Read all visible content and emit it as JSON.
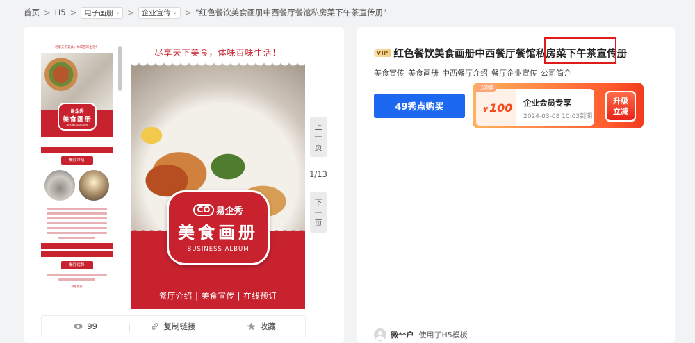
{
  "breadcrumb": {
    "home": "首页",
    "sep": ">",
    "h5": "H5",
    "cat1": "电子画册",
    "cat2": "企业宣传",
    "current": "\"红色餐饮美食画册中西餐厅餐馆私房菜下午茶宣传册\""
  },
  "preview": {
    "thumb_top_text": "尽享天下美食，体味百味生活！",
    "thumb_logo": "易企秀",
    "thumb_title": "美食画册",
    "thumb_sub": "BUSINESS ALBUM",
    "thumb_tag1": "餐厅介绍",
    "thumb_tag2": "餐厅优势",
    "thumb_small": "联系我们",
    "top_text": "尽享天下美食，体味百味生活！",
    "logo": "易企秀",
    "logo_mark": "CO",
    "album_title": "美食画册",
    "album_sub": "BUSINESS ALBUM",
    "bottom_text": "餐厅介绍 | 美食宣传 | 在线预订"
  },
  "pager": {
    "prev": [
      "上",
      "一",
      "页"
    ],
    "count": "1/13",
    "next": [
      "下",
      "一",
      "页"
    ]
  },
  "actions": {
    "views": "99",
    "copy_link": "复制链接",
    "favorite": "收藏"
  },
  "detail": {
    "vip": "VIP",
    "title": "红色餐饮美食画册中西餐厅餐馆私房菜下午茶宣传册",
    "tags": [
      "美食宣传",
      "美食画册",
      "中西餐厅介绍",
      "餐厅企业宣传",
      "公司简介"
    ],
    "buy_label": "49秀点购买",
    "coupon": {
      "claimed": "已领取",
      "currency": "¥",
      "amount": "100",
      "name": "企业会员专享",
      "expiry": "2024-03-08 10:03到期",
      "upgrade_line1": "升级",
      "upgrade_line2": "立减"
    },
    "user": {
      "name": "微**户",
      "action": "使用了H5模板"
    }
  },
  "colors": {
    "brand_red": "#c8222f",
    "buy_blue": "#1d68f0",
    "coupon_orange": "#ff5b2e",
    "highlight_red": "#e11b1b"
  }
}
